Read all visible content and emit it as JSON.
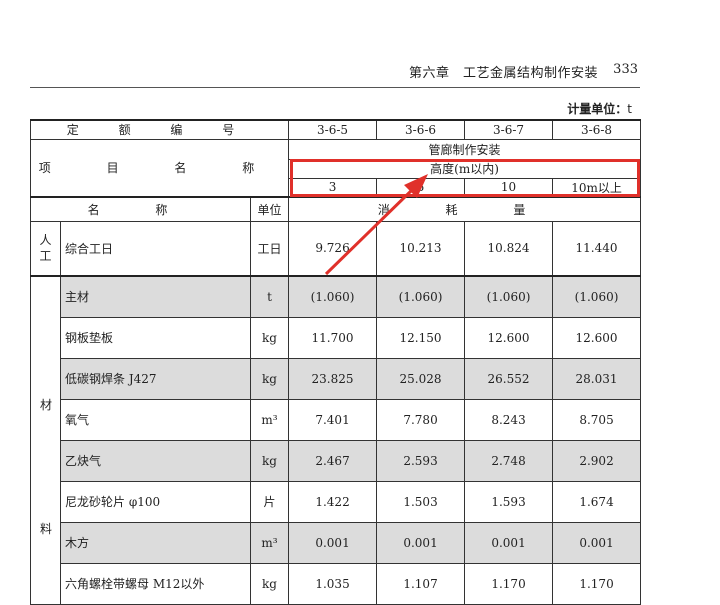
{
  "header": {
    "chapter": "第六章　工艺金属结构制作安装",
    "page": "333"
  },
  "unit": {
    "label": "计量单位",
    "value": "t"
  },
  "table": {
    "code_label": "定 额 编 号",
    "codes": [
      "3-6-5",
      "3-6-6",
      "3-6-7",
      "3-6-8"
    ],
    "item_label": "项 目 名 称",
    "group": "管廊制作安装",
    "subgroup": "高度(m以内)",
    "heights": [
      "3",
      "5",
      "10",
      "10m以上"
    ],
    "col_name": "名 称",
    "col_unit": "单位",
    "col_consume": "消 耗 量",
    "labor_cat": [
      "人",
      "工"
    ],
    "labor": {
      "name": "综合工日",
      "unit": "工日",
      "values": [
        "9.726",
        "10.213",
        "10.824",
        "11.440"
      ]
    },
    "material_cat_top": "材",
    "material_cat_bottom": "料",
    "materials": [
      {
        "name": "主材",
        "unit": "t",
        "values": [
          "(1.060)",
          "(1.060)",
          "(1.060)",
          "(1.060)"
        ]
      },
      {
        "name": "钢板垫板",
        "unit": "kg",
        "values": [
          "11.700",
          "12.150",
          "12.600",
          "12.600"
        ]
      },
      {
        "name": "低碳钢焊条 J427",
        "unit": "kg",
        "values": [
          "23.825",
          "25.028",
          "26.552",
          "28.031"
        ]
      },
      {
        "name": "氧气",
        "unit": "m³",
        "values": [
          "7.401",
          "7.780",
          "8.243",
          "8.705"
        ]
      },
      {
        "name": "乙炔气",
        "unit": "kg",
        "values": [
          "2.467",
          "2.593",
          "2.748",
          "2.902"
        ]
      },
      {
        "name": "尼龙砂轮片 φ100",
        "unit": "片",
        "values": [
          "1.422",
          "1.503",
          "1.593",
          "1.674"
        ]
      },
      {
        "name": "木方",
        "unit": "m³",
        "values": [
          "0.001",
          "0.001",
          "0.001",
          "0.001"
        ]
      },
      {
        "name": "六角螺栓带螺母 M12以外",
        "unit": "kg",
        "values": [
          "1.035",
          "1.107",
          "1.170",
          "1.170"
        ]
      }
    ]
  },
  "annotation": {
    "color": "#e0302a"
  }
}
